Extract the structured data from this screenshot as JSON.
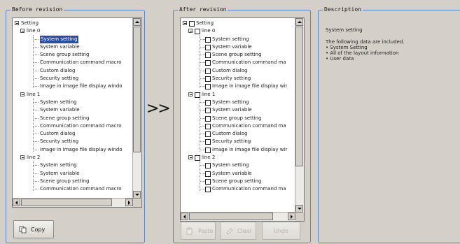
{
  "before": {
    "title": "Before revision",
    "tree": [
      {
        "label": "Setting",
        "depth": 0,
        "type": "root"
      },
      {
        "label": "line 0",
        "depth": 1,
        "type": "group"
      },
      {
        "label": "System setting",
        "depth": 2,
        "type": "item",
        "selected": true
      },
      {
        "label": "System variable",
        "depth": 2,
        "type": "item"
      },
      {
        "label": "Scene group setting",
        "depth": 2,
        "type": "item"
      },
      {
        "label": "Communication command macro",
        "depth": 2,
        "type": "item"
      },
      {
        "label": "Custom dialog",
        "depth": 2,
        "type": "item"
      },
      {
        "label": "Security setting",
        "depth": 2,
        "type": "item"
      },
      {
        "label": "Image in image file display windo",
        "depth": 2,
        "type": "item"
      },
      {
        "label": "line 1",
        "depth": 1,
        "type": "group"
      },
      {
        "label": "System setting",
        "depth": 2,
        "type": "item"
      },
      {
        "label": "System variable",
        "depth": 2,
        "type": "item"
      },
      {
        "label": "Scene group setting",
        "depth": 2,
        "type": "item"
      },
      {
        "label": "Communication command macro",
        "depth": 2,
        "type": "item"
      },
      {
        "label": "Custom dialog",
        "depth": 2,
        "type": "item"
      },
      {
        "label": "Security setting",
        "depth": 2,
        "type": "item"
      },
      {
        "label": "Image in image file display windo",
        "depth": 2,
        "type": "item"
      },
      {
        "label": "line 2",
        "depth": 1,
        "type": "group"
      },
      {
        "label": "System setting",
        "depth": 2,
        "type": "item"
      },
      {
        "label": "System variable",
        "depth": 2,
        "type": "item"
      },
      {
        "label": "Scene group setting",
        "depth": 2,
        "type": "item"
      },
      {
        "label": "Communication command macro",
        "depth": 2,
        "type": "item"
      }
    ],
    "copy_label": "Copy",
    "copy_icon": "copy-icon"
  },
  "separator": ">>",
  "after": {
    "title": "After revision",
    "tree": [
      {
        "label": "Setting",
        "depth": 0,
        "type": "root"
      },
      {
        "label": "line 0",
        "depth": 1,
        "type": "group"
      },
      {
        "label": "System setting",
        "depth": 2,
        "type": "item"
      },
      {
        "label": "System variable",
        "depth": 2,
        "type": "item"
      },
      {
        "label": "Scene group setting",
        "depth": 2,
        "type": "item"
      },
      {
        "label": "Communication command ma",
        "depth": 2,
        "type": "item"
      },
      {
        "label": "Custom dialog",
        "depth": 2,
        "type": "item"
      },
      {
        "label": "Security setting",
        "depth": 2,
        "type": "item"
      },
      {
        "label": "Image in image file display wir",
        "depth": 2,
        "type": "item"
      },
      {
        "label": "line 1",
        "depth": 1,
        "type": "group"
      },
      {
        "label": "System setting",
        "depth": 2,
        "type": "item"
      },
      {
        "label": "System variable",
        "depth": 2,
        "type": "item"
      },
      {
        "label": "Scene group setting",
        "depth": 2,
        "type": "item"
      },
      {
        "label": "Communication command ma",
        "depth": 2,
        "type": "item"
      },
      {
        "label": "Custom dialog",
        "depth": 2,
        "type": "item"
      },
      {
        "label": "Security setting",
        "depth": 2,
        "type": "item"
      },
      {
        "label": "Image in image file display wir",
        "depth": 2,
        "type": "item"
      },
      {
        "label": "line 2",
        "depth": 1,
        "type": "group"
      },
      {
        "label": "System setting",
        "depth": 2,
        "type": "item"
      },
      {
        "label": "System variable",
        "depth": 2,
        "type": "item"
      },
      {
        "label": "Scene group setting",
        "depth": 2,
        "type": "item"
      },
      {
        "label": "Communication command ma",
        "depth": 2,
        "type": "item"
      }
    ],
    "buttons": [
      {
        "name": "paste-button",
        "label": "Paste",
        "icon": "paste-icon",
        "enabled": false
      },
      {
        "name": "clear-button",
        "label": "Clear",
        "icon": "clear-icon",
        "enabled": false
      },
      {
        "name": "undo-button",
        "label": "Undo",
        "icon": "",
        "enabled": false
      }
    ]
  },
  "description": {
    "title": "Description",
    "heading": "System setting",
    "intro": "The following data are included.",
    "bullets": [
      "• System Setting",
      "• All of the layout information",
      "• User data"
    ]
  }
}
